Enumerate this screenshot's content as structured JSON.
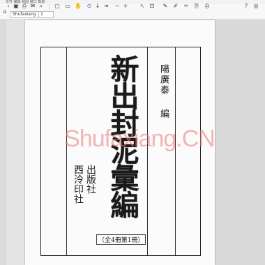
{
  "menubar": {
    "text": "文件  编辑  视图  窗口  帮助"
  },
  "toolbar": {
    "view_select": "Shufaxiang",
    "page_number": "1",
    "icons": [
      "home-icon",
      "back-icon",
      "save-icon",
      "print-icon",
      "mail-icon",
      "search-icon",
      "page-up-icon",
      "page-down-icon",
      "zoom-out-icon",
      "zoom-in-icon",
      "select-icon",
      "hand-icon",
      "comment-icon",
      "highlight-icon",
      "sign-icon",
      "share-icon",
      "help-icon",
      "user-icon"
    ]
  },
  "document": {
    "title": "新出封泥彙編",
    "author_name": "陽廣泰",
    "author_role": "編",
    "publisher_line1": "西泠印社",
    "publisher_line2": "出版社",
    "volume_note": "（全4冊第1冊）"
  },
  "watermark": {
    "text": "Shufaxiang.CN"
  },
  "colors": {
    "watermark": "#ec7878",
    "ink": "#111111"
  }
}
